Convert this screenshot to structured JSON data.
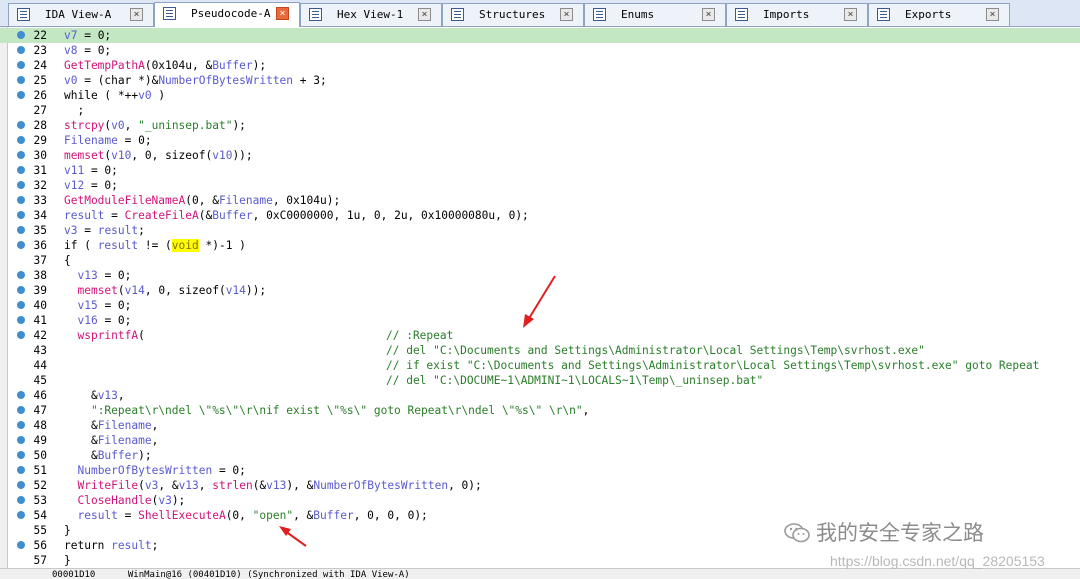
{
  "tabs": [
    {
      "label": "IDA View-A",
      "active": false
    },
    {
      "label": "Pseudocode-A",
      "active": true
    },
    {
      "label": "Hex View-1",
      "active": false
    },
    {
      "label": "Structures",
      "active": false
    },
    {
      "label": "Enums",
      "active": false
    },
    {
      "label": "Imports",
      "active": false
    },
    {
      "label": "Exports",
      "active": false
    }
  ],
  "tab_close_glyph": "×",
  "code_lines": [
    {
      "num": "22",
      "text": "v7 = 0;"
    },
    {
      "num": "23",
      "text": "v8 = 0;"
    },
    {
      "num": "24",
      "text": "GetTempPathA(0x104u, &Buffer);"
    },
    {
      "num": "25",
      "text": "v0 = (char *)&NumberOfBytesWritten + 3;"
    },
    {
      "num": "26",
      "text": "while ( *++v0 )"
    },
    {
      "num": "27",
      "text": "  ;"
    },
    {
      "num": "28",
      "text": "strcpy(v0, \"_uninsep.bat\");"
    },
    {
      "num": "29",
      "text": "Filename = 0;"
    },
    {
      "num": "30",
      "text": "memset(v10, 0, sizeof(v10));"
    },
    {
      "num": "31",
      "text": "v11 = 0;"
    },
    {
      "num": "32",
      "text": "v12 = 0;"
    },
    {
      "num": "33",
      "text": "GetModuleFileNameA(0, &Filename, 0x104u);"
    },
    {
      "num": "34",
      "text": "result = CreateFileA(&Buffer, 0xC0000000, 1u, 0, 2u, 0x10000080u, 0);"
    },
    {
      "num": "35",
      "text": "v3 = result;"
    },
    {
      "num": "36",
      "text": "if ( result != (void *)-1 )"
    },
    {
      "num": "37",
      "text": "{"
    },
    {
      "num": "38",
      "text": "  v13 = 0;"
    },
    {
      "num": "39",
      "text": "  memset(v14, 0, sizeof(v14));"
    },
    {
      "num": "40",
      "text": "  v15 = 0;"
    },
    {
      "num": "41",
      "text": "  v16 = 0;"
    },
    {
      "num": "42",
      "text": "  wsprintfA(",
      "comment": "// :Repeat"
    },
    {
      "num": "43",
      "text": "",
      "comment": "// del \"C:\\Documents and Settings\\Administrator\\Local Settings\\Temp\\svrhost.exe\""
    },
    {
      "num": "44",
      "text": "",
      "comment": "// if exist \"C:\\Documents and Settings\\Administrator\\Local Settings\\Temp\\svrhost.exe\" goto Repeat"
    },
    {
      "num": "45",
      "text": "",
      "comment": "// del \"C:\\DOCUME~1\\ADMINI~1\\LOCALS~1\\Temp\\_uninsep.bat\""
    },
    {
      "num": "46",
      "text": "    &v13,"
    },
    {
      "num": "47",
      "text": "    \":Repeat\\r\\ndel \\\"%s\\\"\\r\\nif exist \\\"%s\\\" goto Repeat\\r\\ndel \\\"%s\\\" \\r\\n\","
    },
    {
      "num": "48",
      "text": "    &Filename,"
    },
    {
      "num": "49",
      "text": "    &Filename,"
    },
    {
      "num": "50",
      "text": "    &Buffer);"
    },
    {
      "num": "51",
      "text": "  NumberOfBytesWritten = 0;"
    },
    {
      "num": "52",
      "text": "  WriteFile(v3, &v13, strlen(&v13), &NumberOfBytesWritten, 0);"
    },
    {
      "num": "53",
      "text": "  CloseHandle(v3);"
    },
    {
      "num": "54",
      "text": "  result = ShellExecuteA(0, \"open\", &Buffer, 0, 0, 0);"
    },
    {
      "num": "55",
      "text": "}"
    },
    {
      "num": "56",
      "text": "return result;"
    },
    {
      "num": "57",
      "text": "}"
    }
  ],
  "status_text": "00001D10      WinMain@16 (00401D10) (Synchronized with IDA View-A)",
  "watermark": {
    "title": "我的安全专家之路",
    "url": "https://blog.csdn.net/qq_28205153"
  },
  "colors": {
    "variable": "#5a5ad0",
    "function": "#d0147a",
    "comment": "#2a7d2a",
    "current_line": "#c3e6c3",
    "breakpoint_dot": "#3f8fd0",
    "annotation_arrow": "#e02020"
  }
}
